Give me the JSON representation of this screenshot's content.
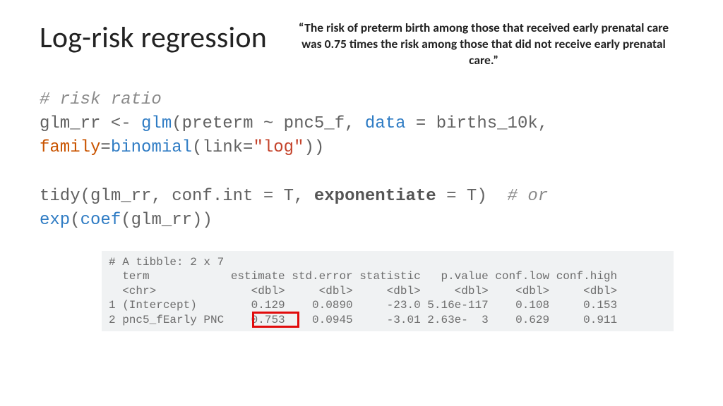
{
  "title": "Log-risk regression",
  "quote": "“The risk of preterm birth among those that received\nearly prenatal care was 0.75 times the risk among\nthose that did not receive early prenatal care.”",
  "code": {
    "comment1": "# risk ratio",
    "l1_a": "glm_rr <- ",
    "l1_fn": "glm",
    "l1_b": "(preterm ~ pnc5_f, ",
    "l1_kw1": "data",
    "l1_c": " = births_10k, ",
    "l2_arg": "family",
    "l2_eq": "=",
    "l2_fn": "binomial",
    "l2_a": "(link=",
    "l2_str": "\"log\"",
    "l2_b": "))",
    "l4_a": "tidy(glm_rr, conf.int = T, ",
    "l4_bold": "exponentiate",
    "l4_b": " = T)  ",
    "l4_comment": "# or",
    "l5_fn1": "exp",
    "l5_a": "(",
    "l5_fn2": "coef",
    "l5_b": "(glm_rr))"
  },
  "chart_data": {
    "type": "table",
    "header_line": "# A tibble: 2 x 7",
    "columns": [
      "term",
      "estimate",
      "std.error",
      "statistic",
      "p.value",
      "conf.low",
      "conf.high"
    ],
    "types": [
      "<chr>",
      "<dbl>",
      "<dbl>",
      "<dbl>",
      "<dbl>",
      "<dbl>",
      "<dbl>"
    ],
    "rows": [
      {
        "n": "1",
        "term": "(Intercept)",
        "estimate": "0.129",
        "std.error": "0.0890",
        "statistic": "-23.0",
        "p.value": "5.16e-117",
        "conf.low": "0.108",
        "conf.high": "0.153"
      },
      {
        "n": "2",
        "term": "pnc5_fEarly PNC",
        "estimate": "0.753",
        "std.error": "0.0945",
        "statistic": "-3.01",
        "p.value": "2.63e-  3",
        "conf.low": "0.629",
        "conf.high": "0.911"
      }
    ],
    "highlight": {
      "row": 1,
      "col": "estimate"
    }
  },
  "output_text": "# A tibble: 2 x 7\n  term            estimate std.error statistic   p.value conf.low conf.high\n  <chr>              <dbl>     <dbl>     <dbl>     <dbl>    <dbl>     <dbl>\n1 (Intercept)        0.129    0.0890     -23.0 5.16e-117    0.108     0.153\n2 pnc5_fEarly PNC    0.753    0.0945     -3.01 2.63e-  3    0.629     0.911"
}
